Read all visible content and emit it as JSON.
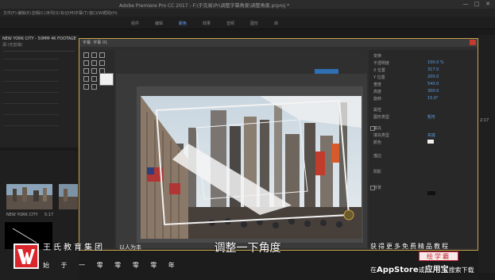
{
  "window": {
    "title": "Adobe Premiere Pro CC 2017 - F:\\于克易\\Pr\\调整字幕角度\\调整角度.prproj *",
    "controls": [
      "—",
      "□",
      "✕"
    ]
  },
  "menu": {
    "items": [
      "文件(F)",
      "编辑(E)",
      "剪辑(C)",
      "序列(S)",
      "标记(M)",
      "字幕(T)",
      "窗口(W)",
      "帮助(H)"
    ]
  },
  "workspace": {
    "tabs": [
      "组件",
      "编辑",
      "颜色",
      "效果",
      "音频",
      "图形",
      "库"
    ],
    "active_index": 2
  },
  "left_panel": {
    "tab_label": "NEW YORK CITY - 50MM 4K FOOTAGE",
    "source_label": "源:(无剪辑)",
    "clip_labels": [
      "NEW YORK CITY",
      "5:17"
    ]
  },
  "dialog": {
    "head_label": "字幕: 字幕 01"
  },
  "properties": {
    "rows": [
      {
        "label": "变换",
        "value": ""
      },
      {
        "label": "不透明度",
        "value": "100.0 %"
      },
      {
        "label": "X 位置",
        "value": "317.0"
      },
      {
        "label": "Y 位置",
        "value": "200.0"
      },
      {
        "label": "宽度",
        "value": "540.0"
      },
      {
        "label": "高度",
        "value": "300.0"
      },
      {
        "label": "旋转",
        "value": "15.0°"
      },
      {
        "label": "属性",
        "value": ""
      },
      {
        "label": "图形类型",
        "value": "矩形"
      },
      {
        "label": "填充",
        "value": ""
      },
      {
        "label": "填充类型",
        "value": "实底"
      },
      {
        "label": "颜色",
        "value": ""
      },
      {
        "label": "描边",
        "value": ""
      },
      {
        "label": "阴影",
        "value": ""
      },
      {
        "label": "背景",
        "value": ""
      }
    ],
    "right_value": "2:17"
  },
  "overlays": {
    "caption": "调整一下角度",
    "brand_name": "王氏教育集团",
    "brand_slogan": "以人为本",
    "brand_letter": "W",
    "bottom_chars": "始 于 一 零 零 零 零 年",
    "promo_line1": "获得更多免费精品教程",
    "promo_badge": "绘学霸",
    "promo_line2_pre": "在",
    "promo_line2_app1": "AppStore",
    "promo_line2_mid": "或",
    "promo_line2_app2": "应用宝",
    "promo_line2_post": "搜索下载"
  },
  "colors": {
    "accent": "#5aa0e8",
    "dialog_border": "#c8a24c",
    "close_red": "#c53a2d",
    "logo_red": "#d9262c",
    "badge_red": "#c0202a"
  }
}
